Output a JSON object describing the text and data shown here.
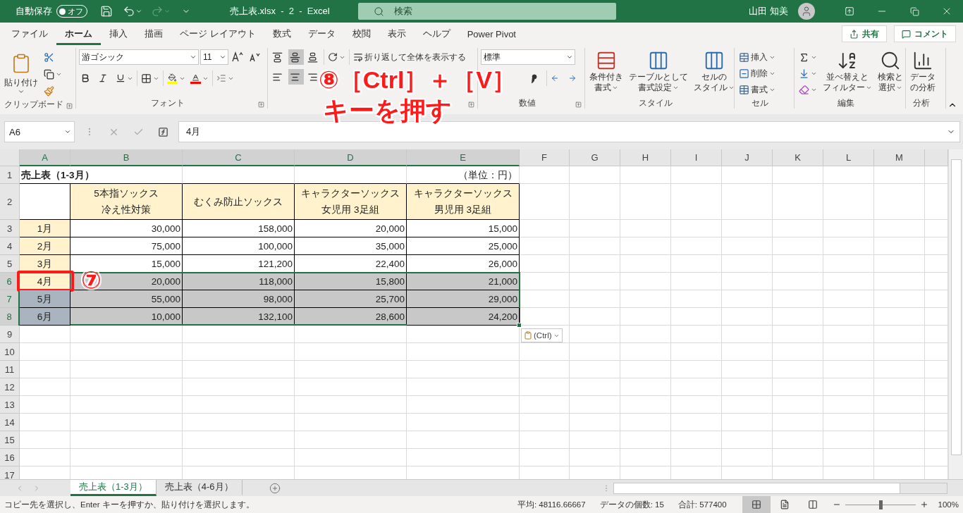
{
  "title_bar": {
    "autosave_label": "自動保存",
    "autosave_state": "オフ",
    "autosave_on": false,
    "document_title": "売上表.xlsx  -  2  -  Excel",
    "search_placeholder": "検索",
    "user_name": "山田 知美"
  },
  "menu_tabs": [
    {
      "label": "ファイル",
      "selected": false
    },
    {
      "label": "ホーム",
      "selected": true
    },
    {
      "label": "挿入",
      "selected": false
    },
    {
      "label": "描画",
      "selected": false
    },
    {
      "label": "ページ レイアウト",
      "selected": false
    },
    {
      "label": "数式",
      "selected": false
    },
    {
      "label": "データ",
      "selected": false
    },
    {
      "label": "校閲",
      "selected": false
    },
    {
      "label": "表示",
      "selected": false
    },
    {
      "label": "ヘルプ",
      "selected": false
    },
    {
      "label": "Power Pivot",
      "selected": false
    }
  ],
  "share_button": "共有",
  "comment_button": "コメント",
  "ribbon": {
    "clipboard": {
      "label": "クリップボード",
      "paste": "貼り付け"
    },
    "font": {
      "label": "フォント",
      "font_name": "游ゴシック",
      "font_size": "11"
    },
    "alignment": {
      "wrap_text": "折り返して全体を表示する",
      "vertical_align": [
        {
          "selected": false
        },
        {
          "selected": true
        },
        {
          "selected": false
        }
      ],
      "horizontal_align": [
        {
          "selected": false
        },
        {
          "selected": true
        },
        {
          "selected": false
        }
      ]
    },
    "number": {
      "label": "数値",
      "format": "標準"
    },
    "styles": {
      "label": "スタイル",
      "buttons": [
        {
          "lines": [
            "条件付き",
            "書式"
          ]
        },
        {
          "lines": [
            "テーブルとして",
            "書式設定"
          ]
        },
        {
          "lines": [
            "セルの",
            "スタイル"
          ]
        }
      ]
    },
    "cells": {
      "label": "セル",
      "buttons": [
        "挿入",
        "削除",
        "書式"
      ]
    },
    "editing": {
      "label": "編集",
      "buttons": [
        {
          "lines": [
            "並べ替えと",
            "フィルター"
          ]
        },
        {
          "lines": [
            "検索と",
            "選択"
          ]
        }
      ]
    },
    "analysis": {
      "label": "分析",
      "buttons": [
        {
          "lines": [
            "データ",
            "の分析"
          ]
        }
      ]
    }
  },
  "formula_bar": {
    "name_box": "A6",
    "value": "4月"
  },
  "sheet": {
    "columns": [
      {
        "label": "A",
        "selected": true
      },
      {
        "label": "B",
        "selected": true
      },
      {
        "label": "C",
        "selected": true
      },
      {
        "label": "D",
        "selected": true
      },
      {
        "label": "E",
        "selected": true
      },
      {
        "label": "F",
        "selected": false
      },
      {
        "label": "G",
        "selected": false
      },
      {
        "label": "H",
        "selected": false
      },
      {
        "label": "I",
        "selected": false
      },
      {
        "label": "J",
        "selected": false
      },
      {
        "label": "K",
        "selected": false
      },
      {
        "label": "L",
        "selected": false
      },
      {
        "label": "M",
        "selected": false
      }
    ],
    "rows": [
      {
        "header": "1",
        "selected": false,
        "kind": "title",
        "cells": [
          "売上表（1-3月）",
          "（単位：円）"
        ]
      },
      {
        "header": "2",
        "selected": false,
        "kind": "header",
        "cells": [
          {
            "lines": [
              "5本指ソックス",
              "冷え性対策"
            ]
          },
          {
            "lines": [
              "むくみ防止ソックス"
            ]
          },
          {
            "lines": [
              "キャラクターソックス",
              "女児用 3足組"
            ]
          },
          {
            "lines": [
              "キャラクターソックス",
              "男児用 3足組"
            ]
          }
        ]
      },
      {
        "header": "3",
        "selected": false,
        "kind": "data",
        "cells": [
          {
            "text": "1月",
            "selected": false,
            "highlighted": false
          },
          {
            "text": "30,000",
            "selected": false,
            "highlighted": false
          },
          {
            "text": "158,000",
            "selected": false,
            "highlighted": false
          },
          {
            "text": "20,000",
            "selected": false,
            "highlighted": false
          },
          {
            "text": "15,000",
            "selected": false,
            "highlighted": false
          }
        ]
      },
      {
        "header": "4",
        "selected": false,
        "kind": "data",
        "cells": [
          {
            "text": "2月",
            "selected": false,
            "highlighted": false
          },
          {
            "text": "75,000",
            "selected": false,
            "highlighted": false
          },
          {
            "text": "100,000",
            "selected": false,
            "highlighted": false
          },
          {
            "text": "35,000",
            "selected": false,
            "highlighted": false
          },
          {
            "text": "25,000",
            "selected": false,
            "highlighted": false
          }
        ]
      },
      {
        "header": "5",
        "selected": false,
        "kind": "data",
        "cells": [
          {
            "text": "3月",
            "selected": false,
            "highlighted": false
          },
          {
            "text": "15,000",
            "selected": false,
            "highlighted": false
          },
          {
            "text": "121,200",
            "selected": false,
            "highlighted": false
          },
          {
            "text": "22,400",
            "selected": false,
            "highlighted": false
          },
          {
            "text": "26,000",
            "selected": false,
            "highlighted": false
          }
        ]
      },
      {
        "header": "6",
        "selected": true,
        "kind": "data",
        "cells": [
          {
            "text": "4月",
            "selected": false,
            "highlighted": true
          },
          {
            "text": "20,000",
            "selected": true,
            "highlighted": false
          },
          {
            "text": "118,000",
            "selected": true,
            "highlighted": false
          },
          {
            "text": "15,800",
            "selected": true,
            "highlighted": false
          },
          {
            "text": "21,000",
            "selected": true,
            "highlighted": false
          }
        ]
      },
      {
        "header": "7",
        "selected": true,
        "kind": "data",
        "cells": [
          {
            "text": "5月",
            "selected": true,
            "highlighted": false
          },
          {
            "text": "55,000",
            "selected": true,
            "highlighted": false
          },
          {
            "text": "98,000",
            "selected": true,
            "highlighted": false
          },
          {
            "text": "25,700",
            "selected": true,
            "highlighted": false
          },
          {
            "text": "29,000",
            "selected": true,
            "highlighted": false
          }
        ]
      },
      {
        "header": "8",
        "selected": true,
        "kind": "data",
        "cells": [
          {
            "text": "6月",
            "selected": true,
            "highlighted": false
          },
          {
            "text": "10,000",
            "selected": true,
            "highlighted": false
          },
          {
            "text": "132,100",
            "selected": true,
            "highlighted": false
          },
          {
            "text": "28,600",
            "selected": true,
            "highlighted": false
          },
          {
            "text": "24,200",
            "selected": true,
            "highlighted": false
          }
        ]
      },
      {
        "header": "9",
        "selected": false,
        "kind": "empty"
      },
      {
        "header": "10",
        "selected": false,
        "kind": "empty"
      },
      {
        "header": "11",
        "selected": false,
        "kind": "empty"
      },
      {
        "header": "12",
        "selected": false,
        "kind": "empty"
      },
      {
        "header": "13",
        "selected": false,
        "kind": "empty"
      },
      {
        "header": "14",
        "selected": false,
        "kind": "empty"
      },
      {
        "header": "15",
        "selected": false,
        "kind": "empty"
      },
      {
        "header": "16",
        "selected": false,
        "kind": "empty"
      },
      {
        "header": "17",
        "selected": false,
        "kind": "empty"
      }
    ],
    "paste_options": "(Ctrl)"
  },
  "annotations": {
    "cell_step": "⑦",
    "instruction_lines": [
      "⑧［Ctrl］＋［V］",
      "キーを押す"
    ]
  },
  "sheet_tabs": [
    {
      "label": "売上表（1-3月）",
      "selected": true
    },
    {
      "label": "売上表（4-6月）",
      "selected": false
    }
  ],
  "status_bar": {
    "message": "コピー先を選択し、Enter キーを押すか、貼り付けを選択します。",
    "stats": [
      "平均: 48116.66667",
      "データの個数: 15",
      "合計: 577400"
    ],
    "view_modes": [
      {
        "selected": true
      },
      {
        "selected": false
      },
      {
        "selected": false
      }
    ],
    "zoom": {
      "level": 0.5,
      "reading": "100%"
    }
  }
}
